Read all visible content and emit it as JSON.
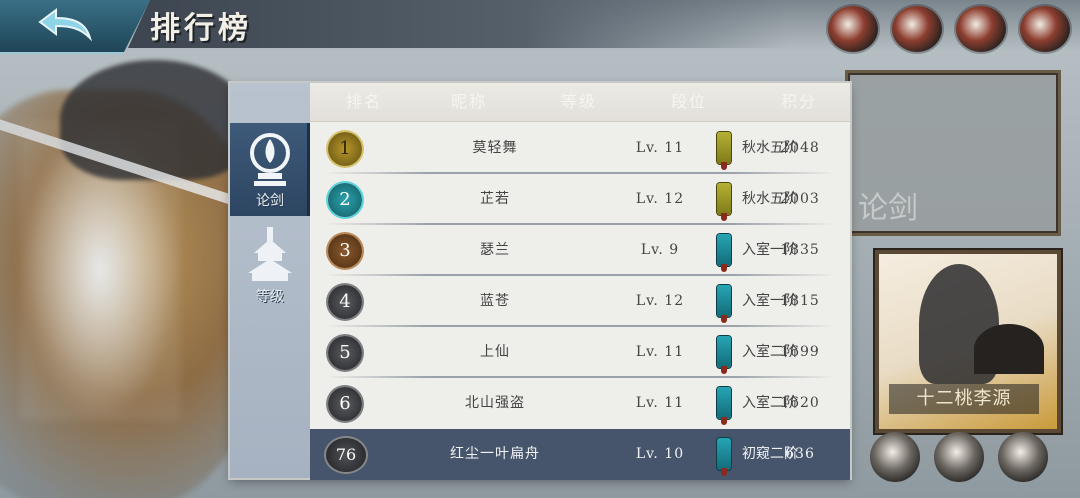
{
  "title": "排行榜",
  "tabs": [
    {
      "label": "论剑",
      "active": true
    },
    {
      "label": "等级",
      "active": false
    }
  ],
  "columns": [
    "排名",
    "昵称",
    "等级",
    "段位",
    "积分"
  ],
  "rows": [
    {
      "rank": "1",
      "name": "莫轻舞",
      "level": "Lv. 11",
      "tier": "秋水五阶",
      "tier_color": "gold",
      "score": "2048",
      "badge": "gold"
    },
    {
      "rank": "2",
      "name": "芷若",
      "level": "Lv. 12",
      "tier": "秋水五阶",
      "tier_color": "gold",
      "score": "2003",
      "badge": "teal"
    },
    {
      "rank": "3",
      "name": "瑟兰",
      "level": "Lv. 9",
      "tier": "入室一阶",
      "tier_color": "teal",
      "score": "1835",
      "badge": "bronze"
    },
    {
      "rank": "4",
      "name": "蓝苍",
      "level": "Lv. 12",
      "tier": "入室一阶",
      "tier_color": "teal",
      "score": "1815",
      "badge": "gray"
    },
    {
      "rank": "5",
      "name": "上仙",
      "level": "Lv. 11",
      "tier": "入室二阶",
      "tier_color": "teal",
      "score": "1699",
      "badge": "gray"
    },
    {
      "rank": "6",
      "name": "北山强盗",
      "level": "Lv. 11",
      "tier": "入室二阶",
      "tier_color": "teal",
      "score": "1620",
      "badge": "gray"
    }
  ],
  "my_row": {
    "rank": "76",
    "name": "红尘一叶扁舟",
    "level": "Lv. 10",
    "tier": "初窥二阶",
    "tier_color": "teal",
    "score": "636",
    "badge": "me"
  },
  "background": {
    "panel_text": "论剑",
    "portrait_banner": "十二桃李源"
  }
}
